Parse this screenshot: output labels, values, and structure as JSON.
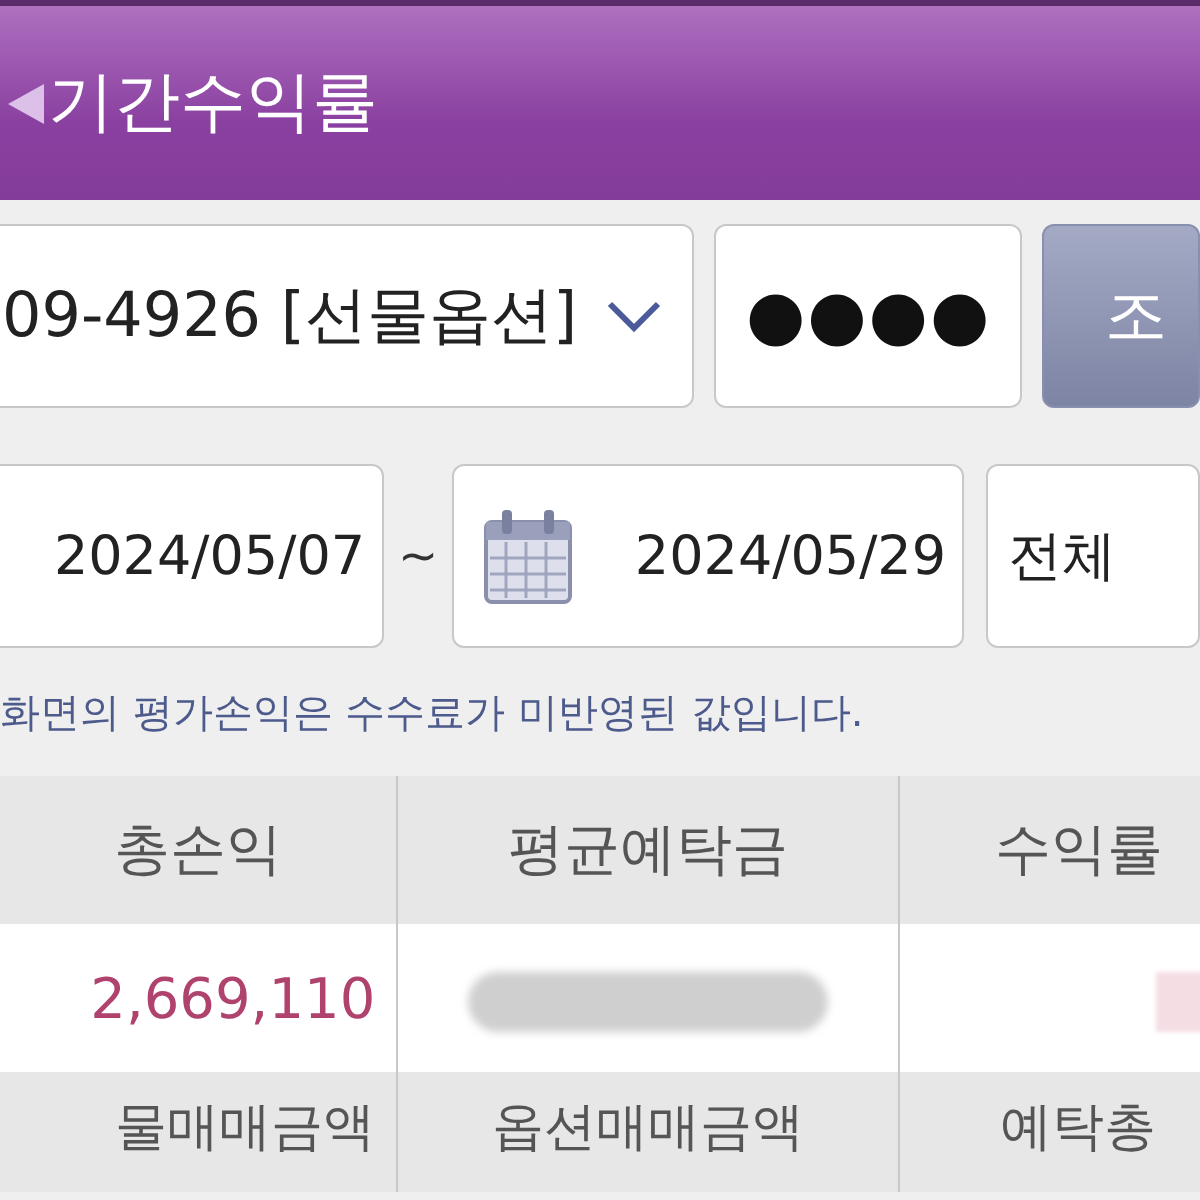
{
  "header": {
    "title": "기간수익률"
  },
  "account": {
    "value": "09-4926 [선물옵션]"
  },
  "password": {
    "value": "●●●●"
  },
  "query_button": {
    "label": "조"
  },
  "period": {
    "start": "2024/05/07",
    "separator": "~",
    "end": "2024/05/29",
    "filter": "전체"
  },
  "notice": "화면의 평가손익은 수수료가 미반영된 값입니다.",
  "table": {
    "columns": [
      "총손익",
      "평균예탁금",
      "수익률"
    ],
    "row": [
      {
        "kind": "text",
        "value": "2,669,110"
      },
      {
        "kind": "redacted"
      },
      {
        "kind": "redacted-pink"
      }
    ],
    "columns_2": [
      "물매매금액",
      "옵션매매금액",
      "예탁총"
    ]
  }
}
